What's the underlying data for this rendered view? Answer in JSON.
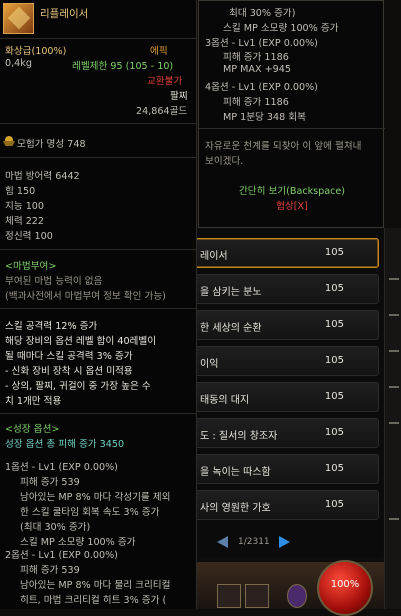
{
  "item": {
    "name": "리플레이서",
    "rarity": "화상급(100%)",
    "category": "에픽",
    "weight": "0,4kg",
    "level_req": "레벨제한 95 (105 - 10)",
    "trade": "교환불가",
    "slot": "팔찌",
    "price": "24,864골드",
    "fame": "모험가 명성 748",
    "stats": [
      "마법 방어력 6442",
      "힘 150",
      "지능 100",
      "체력 222",
      "정신력 100"
    ],
    "magic_seal_header": "<마법부여>",
    "magic_seal_lines": [
      "부여된 마법 능력이 없음",
      "(백과사전에서 마법부여 정보 확인 가능)"
    ],
    "desc_lines": [
      "스킬 공격력 12% 증가",
      "해당 장비의 옵션 레벨 합이 40레벨이",
      "될 때마다 스킬 공격력 3% 증가",
      "- 신화 장비 장착 시 옵션 미적용",
      "- 상의, 팔찌, 귀걸이 중 가장 높은 수",
      "치 1개만 적용"
    ],
    "growth_header": "<성장 옵션>",
    "growth_total": "성장 옵션 총 피해 증가 3450",
    "option1": {
      "title": "1옵션 - Lv1 (EXP 0.00%)",
      "lines": [
        "피해 증가 539",
        "남아있는 MP 8% 마다 각성기를 제외",
        "한 스킬 쿨타임 회복 속도 3% 증가",
        "(최대 30% 증가)",
        "스킬 MP 소모량 100% 증가"
      ]
    },
    "option2": {
      "title": "2옵션 - Lv1 (EXP 0.00%)",
      "lines": [
        "피해 증가 539",
        "남아있는 MP 8% 마다 물리 크리티컬",
        "히트, 마법 크리티컬 히트 3% 증가 ("
      ]
    }
  },
  "tooltip_top": {
    "lines_top": [
      "최대 30% 증가)",
      "스킬 MP 소모량 100% 증가"
    ],
    "option3_title": "3옵션 - Lv1 (EXP 0.00%)",
    "option3_lines": [
      "피해 증가 1186",
      "MP MAX +945"
    ],
    "option4_title": "4옵션 - Lv1 (EXP 0.00%)",
    "option4_lines": [
      "피해 증가 1186",
      "MP 1분당 348 회복"
    ],
    "flavor_lines": [
      "자유로운 천계를 되찾아 이 앞에 펼쳐내",
      "보이겠다."
    ],
    "brief_view": "간단히 보기(Backspace)",
    "synergy": "협상[X]"
  },
  "list": {
    "rows": [
      {
        "name": "레이서",
        "level": "105"
      },
      {
        "name": "을 삼키는 분노",
        "level": "105"
      },
      {
        "name": "한 세상의 순환",
        "level": "105"
      },
      {
        "name": "이익",
        "level": "105"
      },
      {
        "name": "태동의 대지",
        "level": "105"
      },
      {
        "name": "도 : 질서의 창조자",
        "level": "105"
      },
      {
        "name": "을 녹이는 따스함",
        "level": "105"
      },
      {
        "name": "사의 영원한 가호",
        "level": "105"
      }
    ],
    "page": "1/2311"
  },
  "hud": {
    "hp": "100%"
  },
  "colors": {
    "gold": "#e8c67a",
    "epic_orange": "#e0a030",
    "req_green": "#7fd168",
    "trade_red": "#e0413b",
    "option_cyan": "#6fd1c2"
  }
}
